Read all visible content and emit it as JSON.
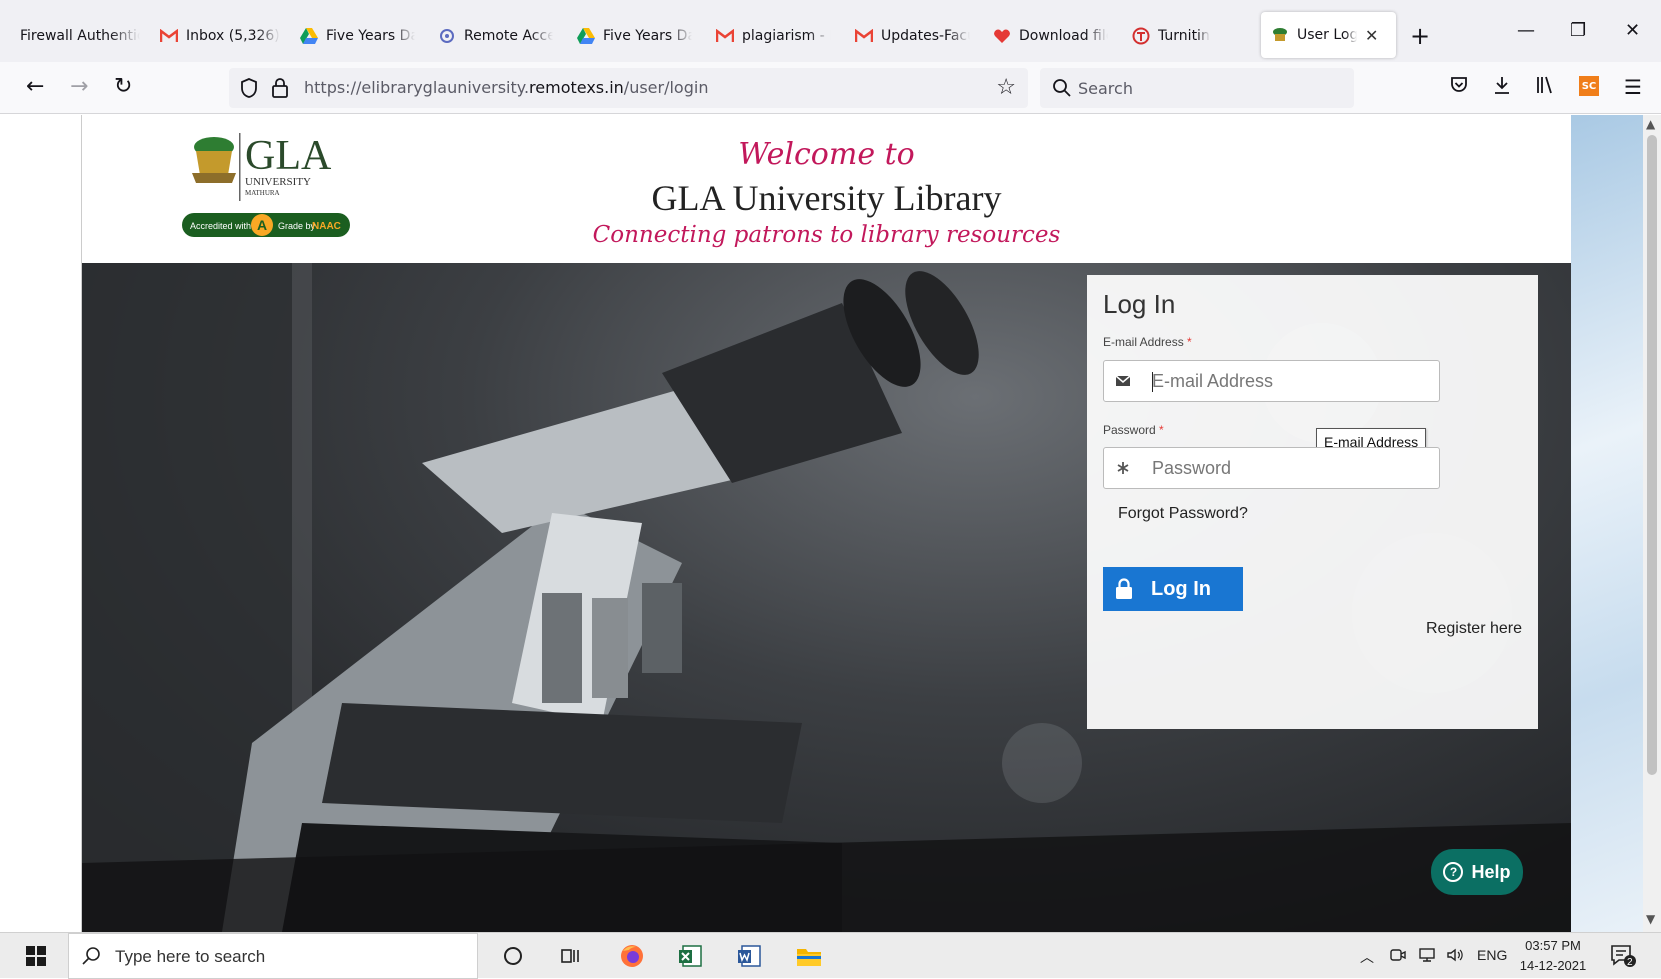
{
  "browser": {
    "tabs": [
      {
        "label": "Firewall Authentic",
        "icon": "none"
      },
      {
        "label": "Inbox (5,326)",
        "icon": "gmail-icon"
      },
      {
        "label": "Five Years Dat",
        "icon": "google-drive-icon"
      },
      {
        "label": "Remote Acce",
        "icon": "remote-access-icon"
      },
      {
        "label": "Five Years Dat",
        "icon": "google-drive-icon"
      },
      {
        "label": "plagiarism - I",
        "icon": "gmail-icon"
      },
      {
        "label": "Updates-Facu",
        "icon": "gmail-icon"
      },
      {
        "label": "Download file",
        "icon": "heart-icon"
      },
      {
        "label": "Turnitin",
        "icon": "turnitin-icon"
      },
      {
        "label": "User Login",
        "icon": "gla-logo-icon"
      }
    ],
    "active_tab_index": 9,
    "url_prefix": "https://elibraryglauniversity.",
    "url_domain": "remotexs.in",
    "url_path": "/user/login",
    "search_placeholder": "Search",
    "extension_badge": "SC"
  },
  "site": {
    "welcome": "Welcome to",
    "library_name": "GLA University Library",
    "tagline": "Connecting patrons to library resources",
    "logo": {
      "name": "GLA",
      "sub": "UNIVERSITY",
      "city": "MATHURA",
      "accredited_prefix": "Accredited with",
      "grade": "A",
      "grade_suffix": "Grade by",
      "agency": "NAAC"
    }
  },
  "login": {
    "title": "Log In",
    "email_label": "E-mail Address",
    "email_placeholder": "E-mail Address",
    "email_tooltip": "E-mail Address",
    "password_label": "Password",
    "password_placeholder": "Password",
    "required_mark": "*",
    "forgot": "Forgot Password?",
    "button": "Log In",
    "register": "Register here"
  },
  "help": {
    "label": "Help",
    "icon_glyph": "?"
  },
  "taskbar": {
    "search_placeholder": "Type here to search",
    "language": "ENG",
    "time": "03:57 PM",
    "date": "14-12-2021",
    "notification_count": "2"
  },
  "colors": {
    "accent_blue": "#1976d2",
    "welcome_pink": "#c2185b",
    "help_green": "#0b6f63",
    "naac_green": "#2e7d32"
  }
}
